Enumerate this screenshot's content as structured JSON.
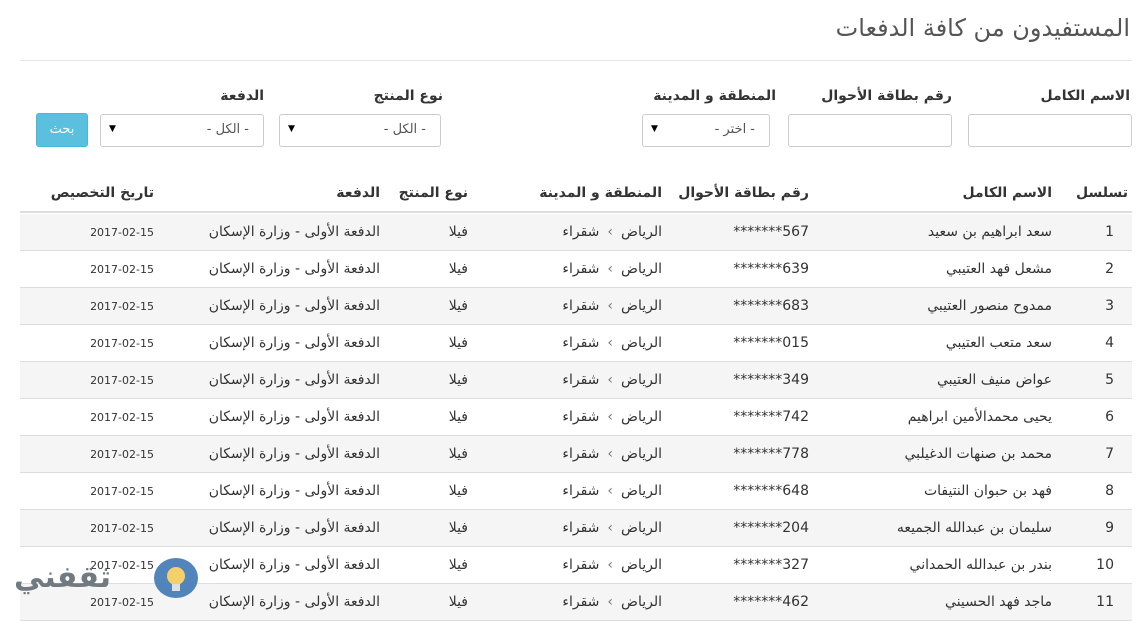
{
  "page": {
    "title": "المستفيدون من كافة الدفعات"
  },
  "filters": {
    "full_name_label": "الاسم الكامل",
    "id_card_label": "رقم بطاقة الأحوال",
    "region_label": "المنطقة و المدينة",
    "region_value": "- اختر -",
    "product_type_label": "نوع المنتج",
    "product_type_value": "- الكل -",
    "batch_label": "الدفعة",
    "batch_value": "- الكل -",
    "search_button": "بحث"
  },
  "table": {
    "columns": {
      "seq": "تسلسل",
      "name": "الاسم الكامل",
      "id": "رقم بطاقة الأحوال",
      "region": "المنطقة و المدينة",
      "product": "نوع المنتج",
      "batch": "الدفعة",
      "date": "تاريخ التخصيص"
    },
    "rows": [
      {
        "seq": "1",
        "name": "سعد ابراهيم بن سعيد",
        "id": "*******567",
        "region": "الرياض",
        "city": "شقراء",
        "product": "فيلا",
        "batch": "الدفعة الأولى - وزارة الإسكان",
        "date": "2017-02-15"
      },
      {
        "seq": "2",
        "name": "مشعل فهد العتيبي",
        "id": "*******639",
        "region": "الرياض",
        "city": "شقراء",
        "product": "فيلا",
        "batch": "الدفعة الأولى - وزارة الإسكان",
        "date": "2017-02-15"
      },
      {
        "seq": "3",
        "name": "ممدوح منصور العتيبي",
        "id": "*******683",
        "region": "الرياض",
        "city": "شقراء",
        "product": "فيلا",
        "batch": "الدفعة الأولى - وزارة الإسكان",
        "date": "2017-02-15"
      },
      {
        "seq": "4",
        "name": "سعد متعب العتيبي",
        "id": "*******015",
        "region": "الرياض",
        "city": "شقراء",
        "product": "فيلا",
        "batch": "الدفعة الأولى - وزارة الإسكان",
        "date": "2017-02-15"
      },
      {
        "seq": "5",
        "name": "عواض منيف العتيبي",
        "id": "*******349",
        "region": "الرياض",
        "city": "شقراء",
        "product": "فيلا",
        "batch": "الدفعة الأولى - وزارة الإسكان",
        "date": "2017-02-15"
      },
      {
        "seq": "6",
        "name": "يحيى محمدالأمين ابراهيم",
        "id": "*******742",
        "region": "الرياض",
        "city": "شقراء",
        "product": "فيلا",
        "batch": "الدفعة الأولى - وزارة الإسكان",
        "date": "2017-02-15"
      },
      {
        "seq": "7",
        "name": "محمد بن صنهات الدغيلبي",
        "id": "*******778",
        "region": "الرياض",
        "city": "شقراء",
        "product": "فيلا",
        "batch": "الدفعة الأولى - وزارة الإسكان",
        "date": "2017-02-15"
      },
      {
        "seq": "8",
        "name": "فهد بن حبوان النتيفات",
        "id": "*******648",
        "region": "الرياض",
        "city": "شقراء",
        "product": "فيلا",
        "batch": "الدفعة الأولى - وزارة الإسكان",
        "date": "2017-02-15"
      },
      {
        "seq": "9",
        "name": "سليمان بن عبدالله الجميعه",
        "id": "*******204",
        "region": "الرياض",
        "city": "شقراء",
        "product": "فيلا",
        "batch": "الدفعة الأولى - وزارة الإسكان",
        "date": "2017-02-15"
      },
      {
        "seq": "10",
        "name": "بندر بن عبدالله الحمداني",
        "id": "*******327",
        "region": "الرياض",
        "city": "شقراء",
        "product": "فيلا",
        "batch": "الدفعة الأولى - وزارة الإسكان",
        "date": "2017-02-15"
      },
      {
        "seq": "11",
        "name": "ماجد فهد الحسيني",
        "id": "*******462",
        "region": "الرياض",
        "city": "شقراء",
        "product": "فيلا",
        "batch": "الدفعة الأولى - وزارة الإسكان",
        "date": "2017-02-15"
      }
    ]
  },
  "watermark": {
    "text": "ثقفني"
  },
  "colors": {
    "search_button": "#5bc0de",
    "row_stripe": "#f5f5f5",
    "border": "#dddddd"
  },
  "icons": {
    "select_arrow": "triangle-down-icon",
    "breadcrumb_separator": "chevron-left-icon",
    "watermark_logo": "lightbulb-icon"
  }
}
